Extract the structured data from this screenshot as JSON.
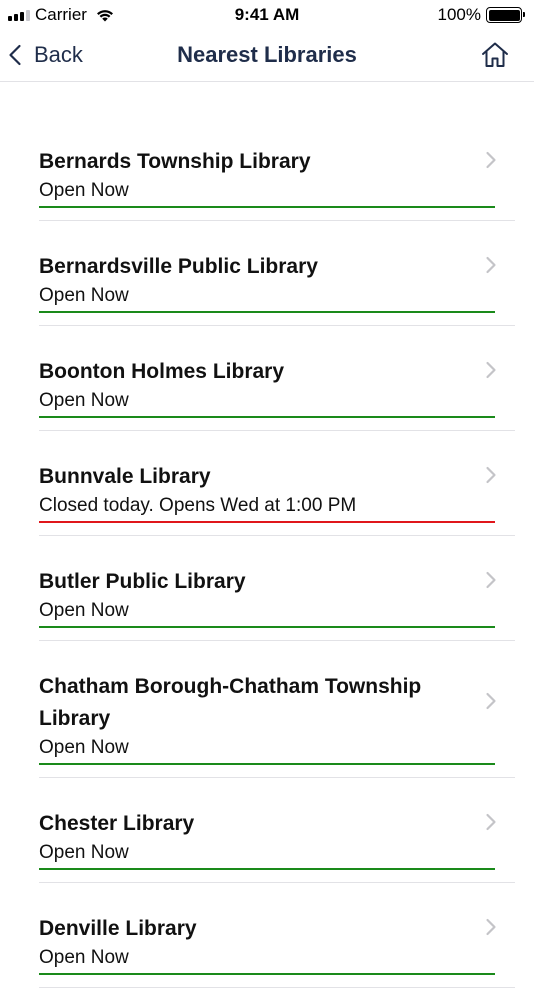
{
  "status_bar": {
    "carrier": "Carrier",
    "time": "9:41 AM",
    "battery": "100%"
  },
  "nav": {
    "back_label": "Back",
    "title": "Nearest Libraries",
    "home_icon": "home-icon"
  },
  "colors": {
    "nav_text": "#1f2d4a",
    "open": "#1a8a1a",
    "closed": "#e0161b",
    "chevron": "#c4c4c8"
  },
  "libraries": [
    {
      "name": "Bernards Township Library",
      "status": "Open Now",
      "state": "open"
    },
    {
      "name": "Bernardsville Public Library",
      "status": "Open Now",
      "state": "open"
    },
    {
      "name": "Boonton Holmes Library",
      "status": "Open Now",
      "state": "open"
    },
    {
      "name": "Bunnvale Library",
      "status": "Closed today. Opens Wed at 1:00 PM",
      "state": "closed"
    },
    {
      "name": "Butler Public Library",
      "status": "Open Now",
      "state": "open"
    },
    {
      "name": "Chatham Borough-Chatham Township Library",
      "status": "Open Now",
      "state": "open"
    },
    {
      "name": "Chester Library",
      "status": "Open Now",
      "state": "open"
    },
    {
      "name": "Denville Library",
      "status": "Open Now",
      "state": "open"
    }
  ]
}
